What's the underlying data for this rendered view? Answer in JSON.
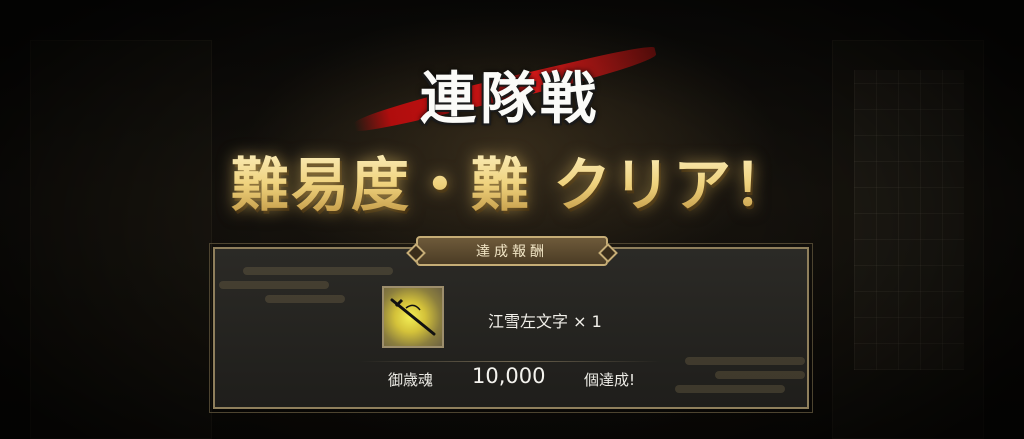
{
  "title": {
    "mode": "連隊戦",
    "clear_message": "難易度・難 クリア！"
  },
  "reward_panel": {
    "header": "達成報酬",
    "item": {
      "icon": "sword-item-icon",
      "name": "江雪左文字 × 1"
    },
    "achievement": {
      "label": "御歳魂",
      "value": "10,000",
      "suffix": "個達成!"
    }
  },
  "colors": {
    "title_gold": "#f1df9a",
    "brush_red": "#d01818",
    "panel_border": "#8f7f5c",
    "panel_bg": "#2b2a26"
  }
}
